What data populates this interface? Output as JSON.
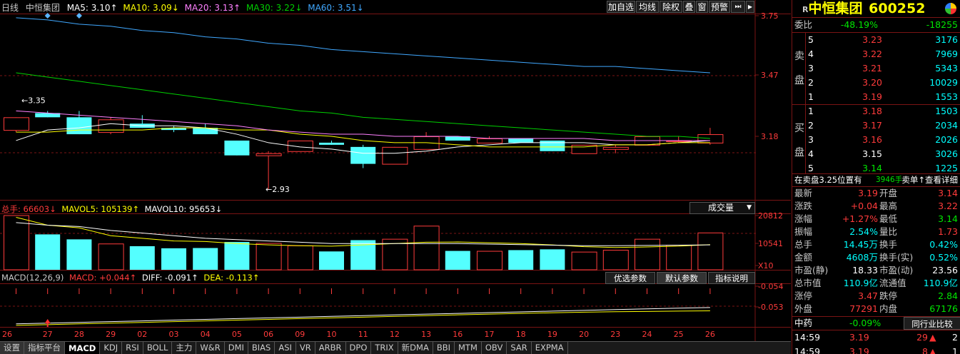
{
  "chart_data": {
    "type": "candlestick",
    "period": "日线",
    "dates": [
      "26",
      "27",
      "28",
      "29",
      "02",
      "03",
      "04",
      "05",
      "06",
      "09",
      "10",
      "11",
      "12",
      "13",
      "16",
      "17",
      "18",
      "19",
      "20",
      "23",
      "24",
      "25",
      "26"
    ],
    "ohlc": [
      [
        3.21,
        3.27,
        3.2,
        3.27
      ],
      [
        3.29,
        3.3,
        3.27,
        3.27
      ],
      [
        3.27,
        3.3,
        3.19,
        3.19
      ],
      [
        3.2,
        3.27,
        3.19,
        3.26
      ],
      [
        3.24,
        3.28,
        3.22,
        3.22
      ],
      [
        3.22,
        3.23,
        3.2,
        3.21
      ],
      [
        3.22,
        3.24,
        3.19,
        3.19
      ],
      [
        3.16,
        3.16,
        3.09,
        3.09
      ],
      [
        3.09,
        3.11,
        2.93,
        3.1
      ],
      [
        3.11,
        3.16,
        3.11,
        3.16
      ],
      [
        3.15,
        3.16,
        3.14,
        3.14
      ],
      [
        3.13,
        3.14,
        3.03,
        3.05
      ],
      [
        3.05,
        3.13,
        3.05,
        3.13
      ],
      [
        3.12,
        3.2,
        3.12,
        3.18
      ],
      [
        3.18,
        3.18,
        3.16,
        3.16
      ],
      [
        3.15,
        3.18,
        3.15,
        3.17
      ],
      [
        3.17,
        3.17,
        3.15,
        3.15
      ],
      [
        3.16,
        3.16,
        3.11,
        3.11
      ],
      [
        3.1,
        3.14,
        3.1,
        3.14
      ],
      [
        3.12,
        3.14,
        3.1,
        3.13
      ],
      [
        3.14,
        3.18,
        3.14,
        3.18
      ],
      [
        3.16,
        3.18,
        3.15,
        3.16
      ],
      [
        3.15,
        3.22,
        3.14,
        3.19
      ]
    ],
    "ma_lines": [
      {
        "name": "MA5",
        "values": [
          3.16,
          3.21,
          3.22,
          3.24,
          3.23,
          3.23,
          3.22,
          3.19,
          3.15,
          3.13,
          3.12,
          3.1,
          3.1,
          3.11,
          3.13,
          3.14,
          3.15,
          3.15,
          3.15,
          3.14,
          3.14,
          3.15,
          3.16
        ],
        "color": "#ffffff"
      },
      {
        "name": "MA10",
        "values": [
          3.2,
          3.2,
          3.21,
          3.21,
          3.21,
          3.22,
          3.22,
          3.21,
          3.21,
          3.19,
          3.18,
          3.16,
          3.15,
          3.15,
          3.14,
          3.13,
          3.13,
          3.13,
          3.13,
          3.14,
          3.14,
          3.15,
          3.15
        ],
        "color": "#ffff00"
      },
      {
        "name": "MA20",
        "values": [
          3.3,
          3.29,
          3.28,
          3.27,
          3.26,
          3.25,
          3.24,
          3.23,
          3.21,
          3.2,
          3.19,
          3.19,
          3.18,
          3.18,
          3.18,
          3.17,
          3.17,
          3.17,
          3.17,
          3.16,
          3.16,
          3.16,
          3.16
        ],
        "color": "#ff80ff"
      },
      {
        "name": "MA30",
        "values": [
          3.48,
          3.46,
          3.44,
          3.42,
          3.4,
          3.38,
          3.36,
          3.34,
          3.32,
          3.3,
          3.29,
          3.27,
          3.26,
          3.25,
          3.24,
          3.23,
          3.22,
          3.21,
          3.2,
          3.19,
          3.18,
          3.18,
          3.17
        ],
        "color": "#00d000"
      },
      {
        "name": "MA60",
        "values": [
          3.74,
          3.73,
          3.71,
          3.7,
          3.68,
          3.67,
          3.65,
          3.64,
          3.62,
          3.61,
          3.59,
          3.58,
          3.57,
          3.56,
          3.55,
          3.54,
          3.53,
          3.52,
          3.51,
          3.51,
          3.5,
          3.49,
          3.48
        ],
        "color": "#40a8ff"
      }
    ],
    "price_ticks": [
      "3.75",
      "3.47",
      "3.18"
    ],
    "price_range": [
      2.88,
      3.76
    ],
    "high_label": "3.35",
    "low_label": "2.93",
    "volume": {
      "values": [
        20812,
        13500,
        11600,
        10000,
        9000,
        8200,
        8300,
        10600,
        10200,
        9300,
        7000,
        11300,
        11800,
        16800,
        7200,
        7200,
        7500,
        7800,
        6900,
        7600,
        11800,
        9500,
        14200
      ],
      "ma5": [
        20000,
        17000,
        16000,
        13000,
        12000,
        11000,
        10800,
        10000,
        9500,
        9200,
        9000,
        9500,
        10000,
        10500,
        10600,
        10300,
        10000,
        9500,
        8800,
        8500,
        8700,
        9000,
        9600
      ],
      "ma10": [
        18000,
        17000,
        16500,
        15000,
        14000,
        13000,
        12000,
        11500,
        11000,
        10500,
        10000,
        10000,
        10000,
        10000,
        10000,
        9800,
        9600,
        9400,
        9200,
        9200,
        9300,
        9400,
        9500
      ],
      "ticks": [
        "20812",
        "10541",
        "X10"
      ],
      "max": 21500
    },
    "macd": {
      "diff": [
        -0.2,
        -0.195,
        -0.19,
        -0.185,
        -0.18,
        -0.175,
        -0.17,
        -0.165,
        -0.16,
        -0.155,
        -0.15,
        -0.145,
        -0.14,
        -0.135,
        -0.13,
        -0.125,
        -0.12,
        -0.115,
        -0.11,
        -0.105,
        -0.1,
        -0.095,
        -0.091
      ],
      "dea": [
        -0.21,
        -0.205,
        -0.2,
        -0.195,
        -0.19,
        -0.185,
        -0.18,
        -0.175,
        -0.17,
        -0.165,
        -0.16,
        -0.155,
        -0.15,
        -0.145,
        -0.14,
        -0.135,
        -0.13,
        -0.126,
        -0.122,
        -0.119,
        -0.117,
        -0.115,
        -0.113
      ],
      "ticks": [
        "-0.054",
        "-0.053"
      ],
      "range": [
        -0.22,
        0.07
      ]
    }
  },
  "header": {
    "title": "日线",
    "stock": "中恒集团",
    "ma5_label": "MA5: 3.10↑",
    "ma10_label": "MA10: 3.09↓",
    "ma20_label": "MA20: 3.13↑",
    "ma30_label": "MA30: 3.22↓",
    "ma60_label": "MA60: 3.51↓"
  },
  "toolbar": {
    "add": "加自选",
    "avg": "均线",
    "rights": "除权",
    "overlay": "叠",
    "window": "窗",
    "alert": "预警"
  },
  "vol_header": {
    "total": "总手: 66603↓",
    "mavol5": "MAVOL5: 105139↑",
    "mavol10": "MAVOL10: 95653↓",
    "dropdown": "成交量"
  },
  "macd_header": {
    "name": "MACD(12,26,9)",
    "macd": "MACD: +0.044↑",
    "diff": "DIFF: -0.091↑",
    "dea": "DEA: -0.113↑",
    "btn1": "优选参数",
    "btn2": "默认参数",
    "btn3": "指标说明"
  },
  "tabs": [
    "设置",
    "指标平台",
    "MACD",
    "KDJ",
    "RSI",
    "BOLL",
    "主力",
    "W&R",
    "DMI",
    "BIAS",
    "ASI",
    "VR",
    "ARBR",
    "DPO",
    "TRIX",
    "新DMA",
    "BBI",
    "MTM",
    "OBV",
    "SAR",
    "EXPMA"
  ],
  "quote": {
    "r": "R",
    "name": "中恒集团",
    "code": "600252",
    "weibi_label": "委比",
    "weibi_pct": "-48.19%",
    "weibi_val": "-18255",
    "sell_label": [
      "卖",
      "盘"
    ],
    "buy_label": [
      "买",
      "盘"
    ],
    "asks": [
      {
        "n": "5",
        "p": "3.23",
        "v": "3176"
      },
      {
        "n": "4",
        "p": "3.22",
        "v": "7969"
      },
      {
        "n": "3",
        "p": "3.21",
        "v": "5343"
      },
      {
        "n": "2",
        "p": "3.20",
        "v": "10029"
      },
      {
        "n": "1",
        "p": "3.19",
        "v": "1553"
      }
    ],
    "bids": [
      {
        "n": "1",
        "p": "3.18",
        "v": "1503"
      },
      {
        "n": "2",
        "p": "3.17",
        "v": "2034"
      },
      {
        "n": "3",
        "p": "3.16",
        "v": "2026"
      },
      {
        "n": "4",
        "p": "3.15",
        "v": "3026"
      },
      {
        "n": "5",
        "p": "3.14",
        "v": "1225"
      }
    ],
    "pending_text": "在卖盘3.25位置有",
    "pending_vol": "3946手",
    "pending_link": "卖单↑查看详细",
    "stats": [
      {
        "l": "最新",
        "v": "3.19",
        "l2": "开盘",
        "v2": "3.14"
      },
      {
        "l": "涨跌",
        "v": "+0.04",
        "l2": "最高",
        "v2": "3.22"
      },
      {
        "l": "涨幅",
        "v": "+1.27%",
        "l2": "最低",
        "v2": "3.14"
      },
      {
        "l": "振幅",
        "v": "2.54%",
        "l2": "量比",
        "v2": "1.73"
      },
      {
        "l": "总手",
        "v": "14.45万",
        "l2": "换手",
        "v2": "0.42%"
      },
      {
        "l": "金额",
        "v": "4608万",
        "l2": "换手(实)",
        "v2": "0.52%"
      },
      {
        "l": "市盈(静)",
        "v": "18.33",
        "l2": "市盈(动)",
        "v2": "23.56"
      },
      {
        "l": "总市值",
        "v": "110.9亿",
        "l2": "流通值",
        "v2": "110.9亿"
      },
      {
        "l": "涨停",
        "v": "3.47",
        "l2": "跌停",
        "v2": "2.84"
      },
      {
        "l": "外盘",
        "v": "77291",
        "l2": "内盘",
        "v2": "67176"
      }
    ],
    "sector": "中药",
    "sector_pct": "-0.09%",
    "sector_btn": "同行业比较",
    "ticks": [
      {
        "t": "14:59",
        "p": "3.19",
        "v": "29",
        "n": "2"
      },
      {
        "t": "14:59",
        "p": "3.19",
        "v": "8",
        "n": "1"
      }
    ]
  },
  "colors": {
    "up": "#ff3b3b",
    "down": "#54ffff",
    "grid": "#7a1414"
  }
}
